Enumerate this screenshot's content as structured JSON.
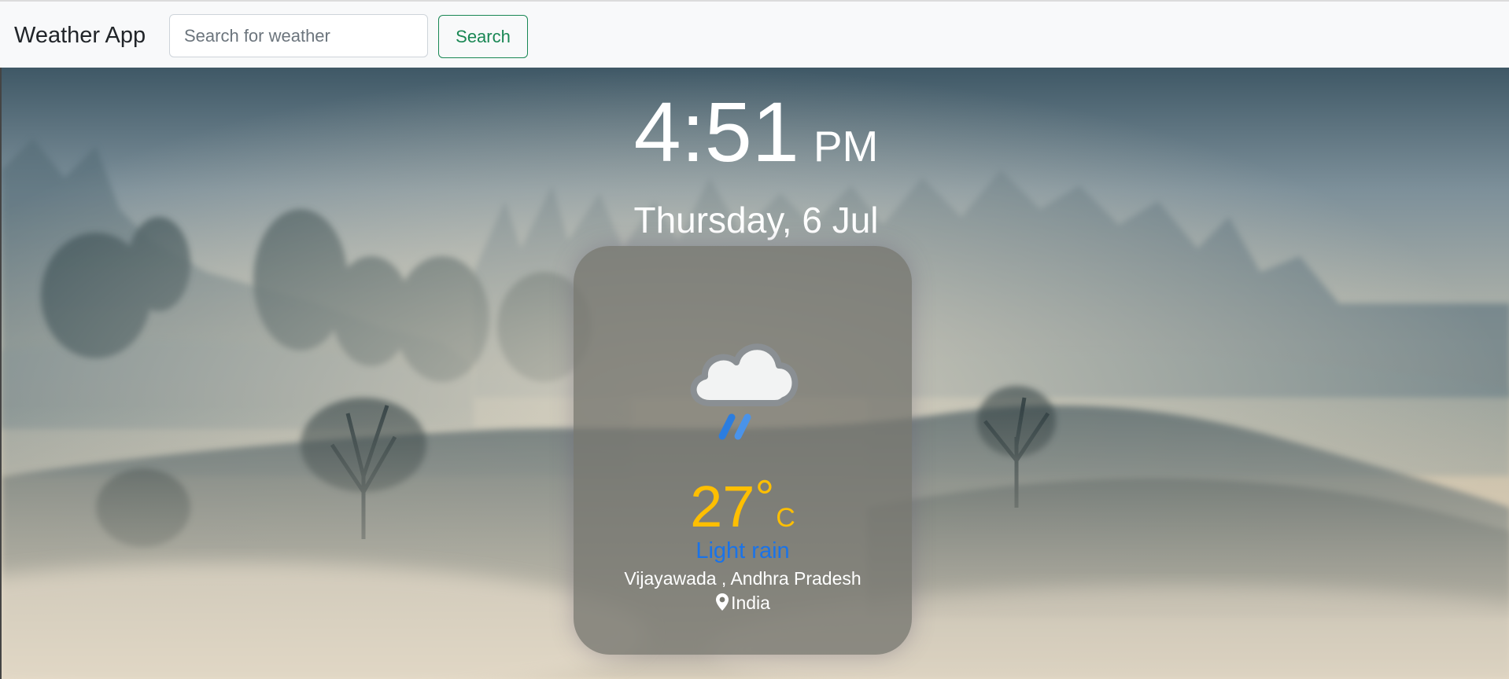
{
  "navbar": {
    "brand": "Weather App",
    "search_placeholder": "Search for weather",
    "search_value": "",
    "search_button": "Search"
  },
  "clock": {
    "time": "4:51",
    "ampm": "PM"
  },
  "date": "Thursday, 6 Jul",
  "weather": {
    "icon": "light-rain-icon",
    "temperature": "27",
    "degree_symbol": "°",
    "unit": "C",
    "condition": "Light rain",
    "location": "Vijayawada , Andhra Pradesh",
    "country": "India",
    "country_icon": "location-pin-icon"
  },
  "colors": {
    "accent_green": "#198754",
    "temperature": "#ffbf00",
    "condition": "#1a73e8",
    "card_background": "rgba(118,118,112,0.78)"
  }
}
